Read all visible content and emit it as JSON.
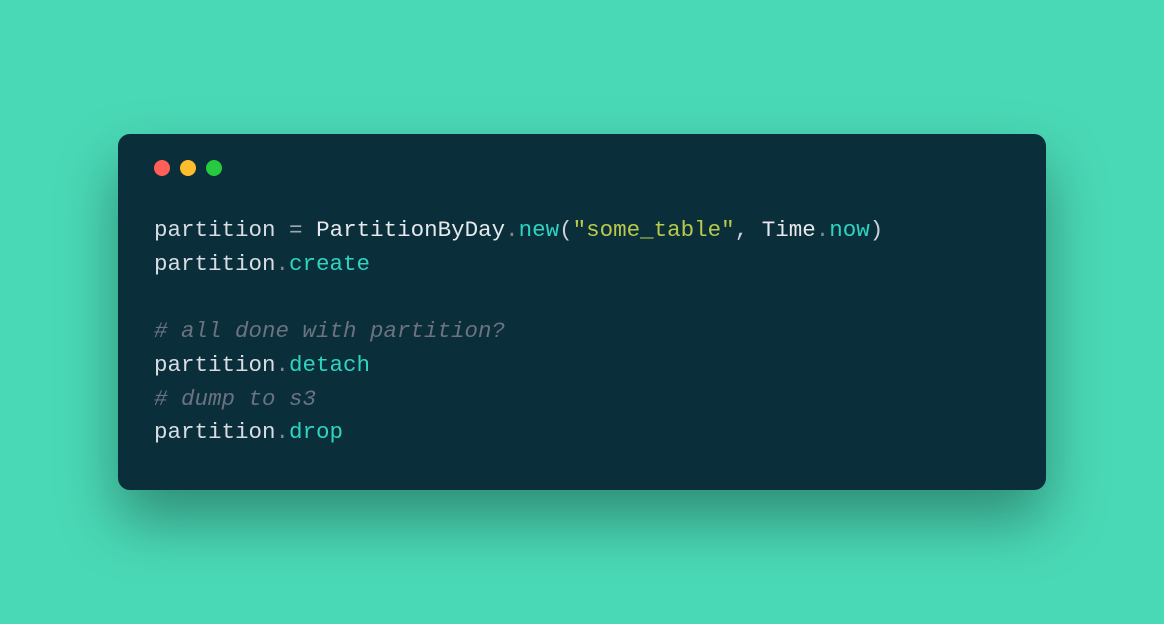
{
  "colors": {
    "background": "#4ad9b6",
    "window": "#0a2e3a",
    "trafficRed": "#ff5f56",
    "trafficYellow": "#ffbd2e",
    "trafficGreen": "#27c93f",
    "var": "#d9dde3",
    "method": "#2dd4bf",
    "string": "#b9c94a",
    "comment": "#6b7280"
  },
  "code": {
    "lines": [
      {
        "tokens": [
          {
            "type": "var",
            "text": "partition"
          },
          {
            "type": "space",
            "text": " "
          },
          {
            "type": "op",
            "text": "="
          },
          {
            "type": "space",
            "text": " "
          },
          {
            "type": "class",
            "text": "PartitionByDay"
          },
          {
            "type": "dot",
            "text": "."
          },
          {
            "type": "method",
            "text": "new"
          },
          {
            "type": "paren",
            "text": "("
          },
          {
            "type": "string",
            "text": "\"some_table\""
          },
          {
            "type": "comma",
            "text": ","
          },
          {
            "type": "space",
            "text": " "
          },
          {
            "type": "const",
            "text": "Time"
          },
          {
            "type": "dot",
            "text": "."
          },
          {
            "type": "method",
            "text": "now"
          },
          {
            "type": "paren",
            "text": ")"
          }
        ]
      },
      {
        "tokens": [
          {
            "type": "var",
            "text": "partition"
          },
          {
            "type": "dot",
            "text": "."
          },
          {
            "type": "method",
            "text": "create"
          }
        ]
      },
      {
        "blank": true
      },
      {
        "tokens": [
          {
            "type": "comment",
            "text": "# all done with partition?"
          }
        ]
      },
      {
        "tokens": [
          {
            "type": "var",
            "text": "partition"
          },
          {
            "type": "dot",
            "text": "."
          },
          {
            "type": "method",
            "text": "detach"
          }
        ]
      },
      {
        "tokens": [
          {
            "type": "comment",
            "text": "# dump to s3"
          }
        ]
      },
      {
        "tokens": [
          {
            "type": "var",
            "text": "partition"
          },
          {
            "type": "dot",
            "text": "."
          },
          {
            "type": "method",
            "text": "drop"
          }
        ]
      }
    ]
  }
}
